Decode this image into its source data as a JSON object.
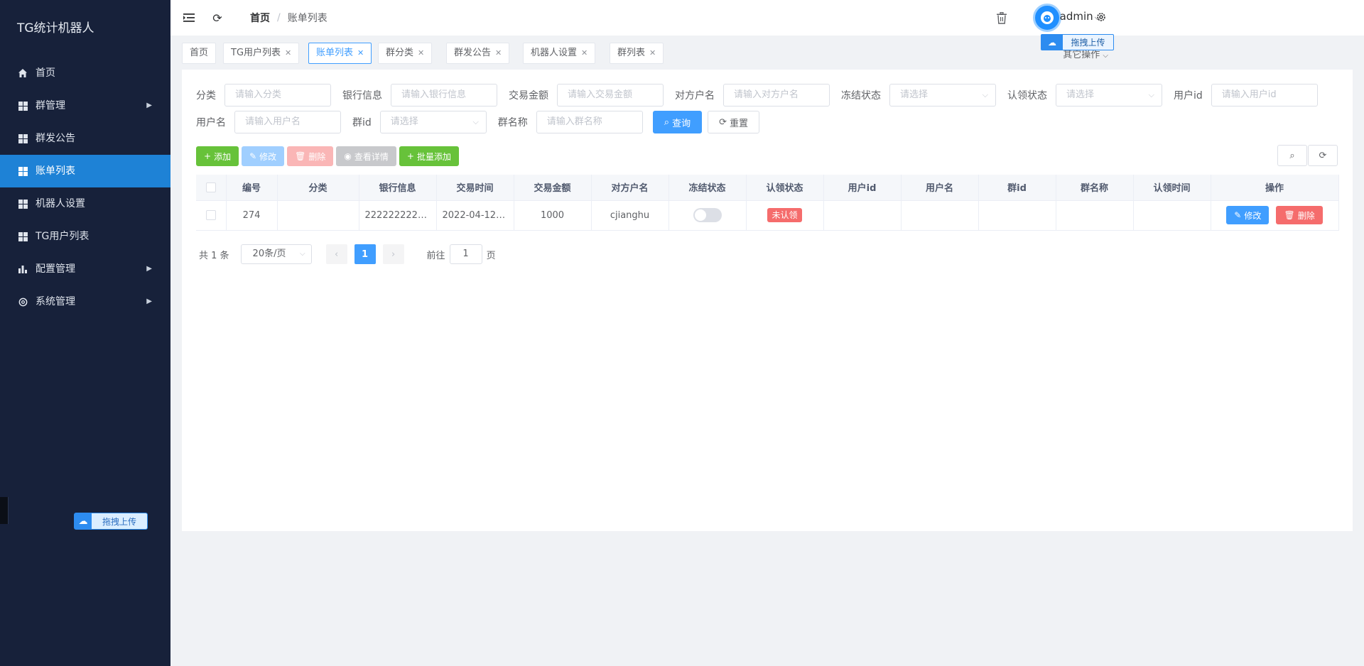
{
  "app": {
    "brand": "TG统计机器人"
  },
  "sidebar": {
    "items": [
      {
        "label": "首页",
        "icon": "home-icon",
        "has_arrow": false,
        "active": false
      },
      {
        "label": "群管理",
        "icon": "grid-icon",
        "has_arrow": true,
        "active": false
      },
      {
        "label": "群发公告",
        "icon": "grid-icon",
        "has_arrow": false,
        "active": false
      },
      {
        "label": "账单列表",
        "icon": "grid-icon",
        "has_arrow": false,
        "active": true
      },
      {
        "label": "机器人设置",
        "icon": "grid-icon",
        "has_arrow": false,
        "active": false
      },
      {
        "label": "TG用户列表",
        "icon": "grid-icon",
        "has_arrow": false,
        "active": false
      },
      {
        "label": "配置管理",
        "icon": "bar-chart-icon",
        "has_arrow": true,
        "active": false
      },
      {
        "label": "系统管理",
        "icon": "gear-icon",
        "has_arrow": true,
        "active": false
      }
    ],
    "upload_label": "拖拽上传"
  },
  "header": {
    "breadcrumb": [
      "首页",
      "账单列表"
    ],
    "breadcrumb_sep": "/",
    "username": "admin",
    "upload_label": "拖拽上传",
    "other_ops": "其它操作"
  },
  "tags": [
    {
      "label": "首页",
      "closable": false,
      "active": false
    },
    {
      "label": "TG用户列表",
      "closable": true,
      "active": false
    },
    {
      "label": "账单列表",
      "closable": true,
      "active": true
    },
    {
      "label": "群分类",
      "closable": true,
      "active": false
    },
    {
      "label": "群发公告",
      "closable": true,
      "active": false
    },
    {
      "label": "机器人设置",
      "closable": true,
      "active": false
    },
    {
      "label": "群列表",
      "closable": true,
      "active": false
    }
  ],
  "filters": {
    "category": {
      "label": "分类",
      "placeholder": "请输入分类"
    },
    "bank": {
      "label": "银行信息",
      "placeholder": "请输入银行信息"
    },
    "amount": {
      "label": "交易金额",
      "placeholder": "请输入交易金额"
    },
    "counterparty": {
      "label": "对方户名",
      "placeholder": "请输入对方户名"
    },
    "frozen": {
      "label": "冻结状态",
      "placeholder": "请选择"
    },
    "claim": {
      "label": "认领状态",
      "placeholder": "请选择"
    },
    "userid": {
      "label": "用户id",
      "placeholder": "请输入用户id"
    },
    "username": {
      "label": "用户名",
      "placeholder": "请输入用户名"
    },
    "groupid": {
      "label": "群id",
      "placeholder": "请选择"
    },
    "groupname": {
      "label": "群名称",
      "placeholder": "请输入群名称"
    },
    "search_label": "查询",
    "reset_label": "重置"
  },
  "toolbar": {
    "add": "添加",
    "edit": "修改",
    "delete": "删除",
    "detail": "查看详情",
    "batch_add": "批量添加"
  },
  "table": {
    "columns": [
      "编号",
      "分类",
      "银行信息",
      "交易时间",
      "交易金额",
      "对方户名",
      "冻结状态",
      "认领状态",
      "用户id",
      "用户名",
      "群id",
      "群名称",
      "认领时间",
      "操作"
    ],
    "rows": [
      {
        "id": "274",
        "category": "",
        "bank": "2222222222...",
        "time": "2022-04-12 ...",
        "amount": "1000",
        "counterparty": "cjianghu",
        "frozen": false,
        "claim_status": "未认领",
        "userid": "",
        "username": "",
        "groupid": "",
        "groupname": "",
        "claim_time": "",
        "edit_label": "修改",
        "delete_label": "删除"
      }
    ]
  },
  "pagination": {
    "total_text": "共 1 条",
    "page_size": "20条/页",
    "current_page": "1",
    "goto_prefix": "前往",
    "goto_value": "1",
    "goto_suffix": "页"
  }
}
